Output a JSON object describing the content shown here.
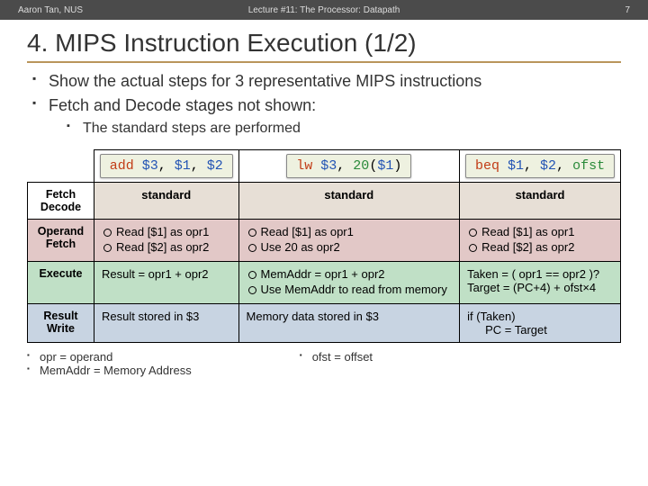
{
  "header": {
    "author": "Aaron Tan, NUS",
    "title": "Lecture #11: The Processor: Datapath",
    "page": "7"
  },
  "section": {
    "title": "4. MIPS Instruction Execution (1/2)"
  },
  "bullets": {
    "b1": "Show the actual steps for 3 representative MIPS instructions",
    "b2": "Fetch and Decode stages not shown:",
    "b2a": "The standard steps are performed"
  },
  "instr": {
    "c1": {
      "op": "add",
      "a1": "$3",
      "a2": "$1",
      "a3": "$2"
    },
    "c2": {
      "op": "lw",
      "a1": "$3",
      "imm": "20",
      "base": "$1"
    },
    "c3": {
      "op": "beq",
      "a1": "$1",
      "a2": "$2",
      "ofst": "ofst"
    }
  },
  "stages": {
    "fetch": "Fetch",
    "decode": "Decode",
    "opf": "Operand Fetch",
    "exe": "Execute",
    "rw": "Result Write",
    "standard": "standard"
  },
  "opf": {
    "c1a": "Read [$1] as opr1",
    "c1b": "Read [$2] as opr2",
    "c2a": "Read [$1] as opr1",
    "c2b": "Use 20 as opr2",
    "c3a": "Read [$1] as opr1",
    "c3b": "Read [$2] as opr2"
  },
  "exe": {
    "c1": "Result = opr1 + opr2",
    "c2a": "MemAddr = opr1 + opr2",
    "c2b": "Use MemAddr to read from memory",
    "c3a": "Taken =  ( opr1 == opr2 )?",
    "c3b": "Target = (PC+4) + ofst×4"
  },
  "rw": {
    "c1": "Result stored in $3",
    "c2": "Memory data stored in $3",
    "c3a": "if (Taken)",
    "c3b": "PC = Target"
  },
  "footnotes": {
    "f1": "opr = operand",
    "f2": "MemAddr = Memory Address",
    "f3": "ofst = offset"
  }
}
